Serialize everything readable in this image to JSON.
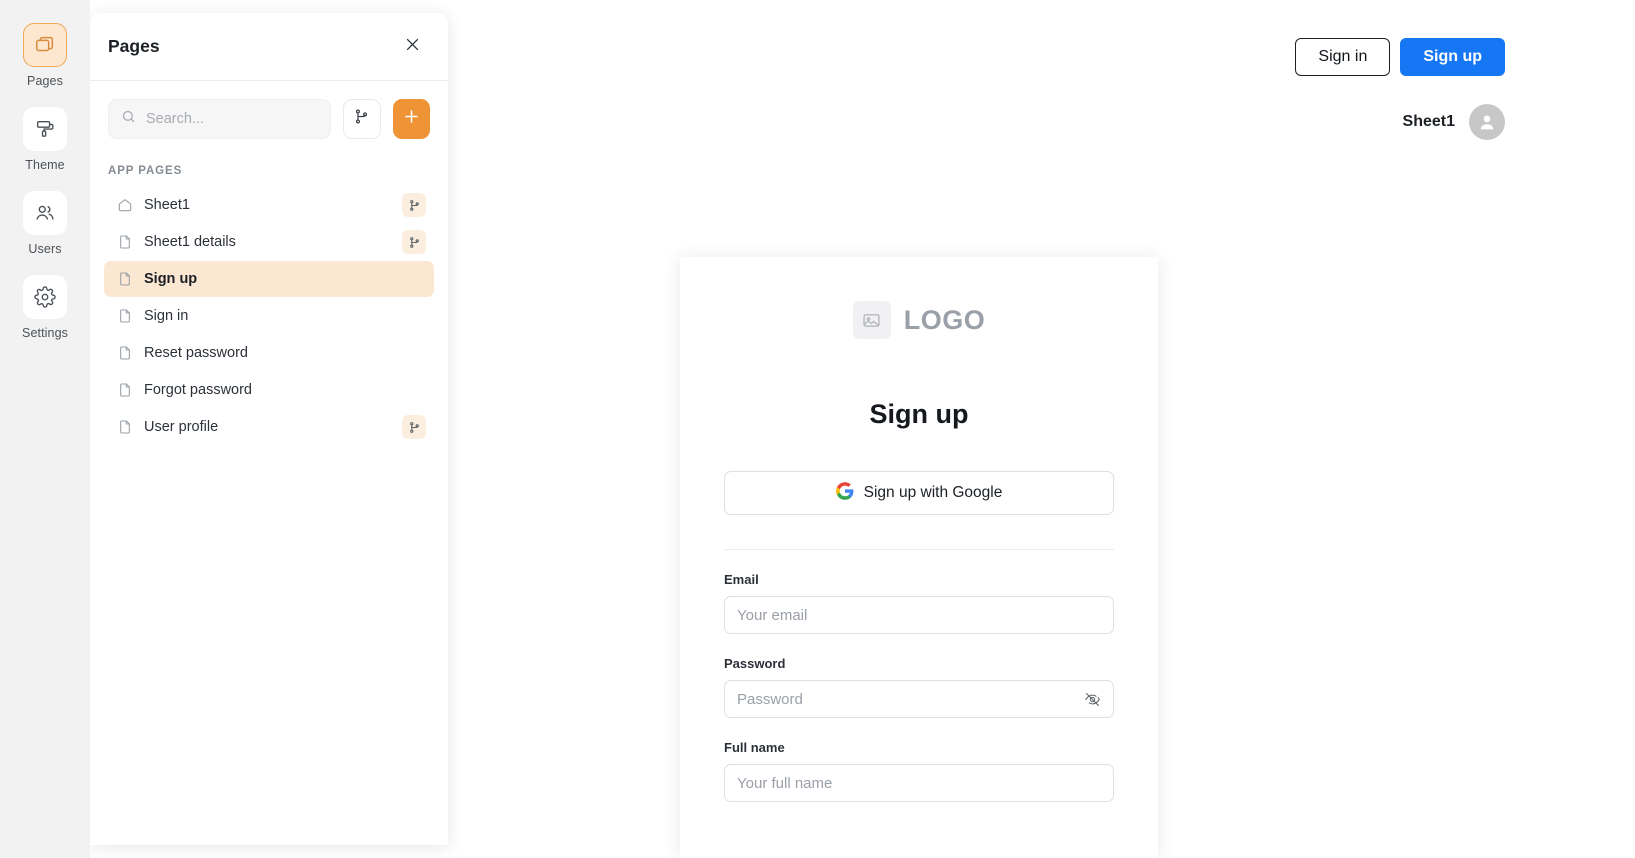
{
  "rail": {
    "items": [
      {
        "label": "Pages",
        "icon": "pages-icon",
        "active": true
      },
      {
        "label": "Theme",
        "icon": "paint-roller-icon",
        "active": false
      },
      {
        "label": "Users",
        "icon": "users-icon",
        "active": false
      },
      {
        "label": "Settings",
        "icon": "gear-icon",
        "active": false
      }
    ]
  },
  "panel": {
    "title": "Pages",
    "close_icon": "close-icon",
    "search": {
      "value": "",
      "placeholder": "Search..."
    },
    "toolbar": {
      "branch_icon": "git-branch-icon",
      "add_icon": "plus-icon"
    },
    "section_label": "APP PAGES",
    "pages": [
      {
        "label": "Sheet1",
        "icon": "home-icon",
        "selected": false,
        "has_branch": true
      },
      {
        "label": "Sheet1 details",
        "icon": "document-icon",
        "selected": false,
        "has_branch": true
      },
      {
        "label": "Sign up",
        "icon": "document-icon",
        "selected": true,
        "has_branch": false
      },
      {
        "label": "Sign in",
        "icon": "document-icon",
        "selected": false,
        "has_branch": false
      },
      {
        "label": "Reset password",
        "icon": "document-icon",
        "selected": false,
        "has_branch": false
      },
      {
        "label": "Forgot password",
        "icon": "document-icon",
        "selected": false,
        "has_branch": false
      },
      {
        "label": "User profile",
        "icon": "document-icon",
        "selected": false,
        "has_branch": true
      }
    ]
  },
  "preview": {
    "header": {
      "sign_in_label": "Sign in",
      "sign_up_label": "Sign up",
      "user_name": "Sheet1",
      "avatar_icon": "user-avatar-icon"
    },
    "card": {
      "logo_icon": "image-placeholder-icon",
      "logo_text": "LOGO",
      "title": "Sign up",
      "google_button": {
        "label": "Sign up with Google",
        "icon": "google-icon"
      },
      "fields": [
        {
          "label": "Email",
          "value": "",
          "placeholder": "Your email",
          "type": "text",
          "toggle_icon": null
        },
        {
          "label": "Password",
          "value": "",
          "placeholder": "Password",
          "type": "password",
          "toggle_icon": "eye-off-icon"
        },
        {
          "label": "Full name",
          "value": "",
          "placeholder": "Your full name",
          "type": "text",
          "toggle_icon": null
        }
      ]
    }
  },
  "colors": {
    "accent_orange": "#ef9337",
    "selected_row": "#fbe7d2",
    "primary_blue": "#1677f5",
    "rail_bg": "#f2f2f3"
  }
}
